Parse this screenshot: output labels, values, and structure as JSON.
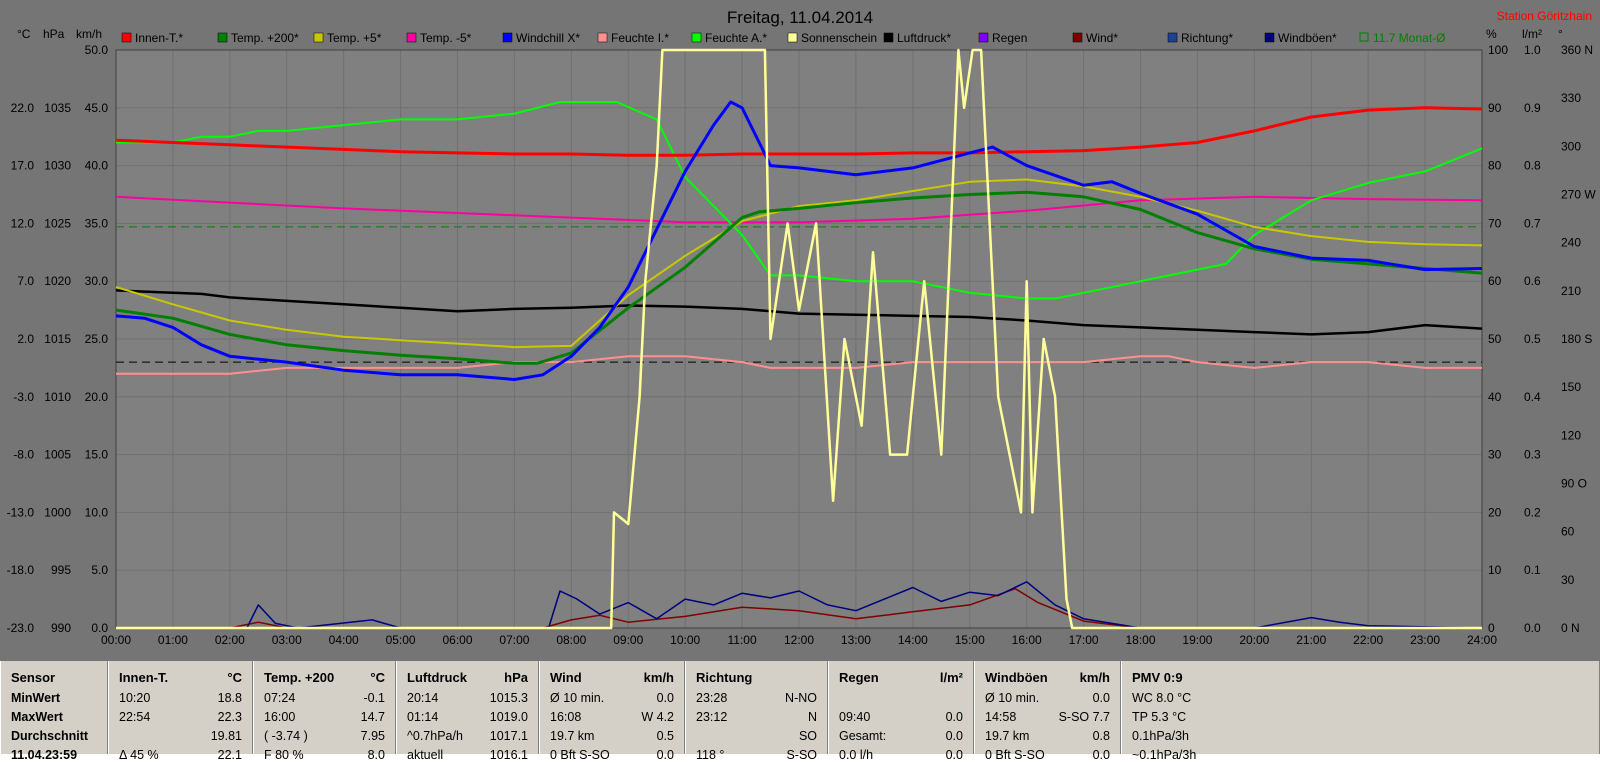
{
  "chart_data": {
    "type": "line",
    "title": "Freitag, 11.04.2014",
    "station": "Station Göritzhain",
    "x_ticks": [
      "00:00",
      "01:00",
      "02:00",
      "03:00",
      "04:00",
      "05:00",
      "06:00",
      "07:00",
      "08:00",
      "09:00",
      "10:00",
      "11:00",
      "12:00",
      "13:00",
      "14:00",
      "15:00",
      "16:00",
      "17:00",
      "18:00",
      "19:00",
      "20:00",
      "21:00",
      "22:00",
      "23:00",
      "24:00"
    ],
    "xlim": [
      0,
      24
    ],
    "axes": {
      "temp": {
        "unit": "°C",
        "ticks": [
          "22.0",
          "17.0",
          "12.0",
          "7.0",
          "2.0",
          "-3.0",
          "-8.0",
          "-13.0",
          "-18.0",
          "-23.0"
        ],
        "range": [
          -23,
          27
        ]
      },
      "pressure": {
        "unit": "hPa",
        "ticks": [
          "1035",
          "1030",
          "1025",
          "1020",
          "1015",
          "1010",
          "1005",
          "1000",
          "995",
          "990"
        ],
        "range": [
          990,
          1040
        ]
      },
      "wind": {
        "unit": "km/h",
        "ticks": [
          "50.0",
          "45.0",
          "40.0",
          "35.0",
          "30.0",
          "25.0",
          "20.0",
          "15.0",
          "10.0",
          "5.0",
          "0.0"
        ],
        "range": [
          0,
          50
        ]
      },
      "humidity": {
        "unit": "%",
        "ticks": [
          "100",
          "90",
          "80",
          "70",
          "60",
          "50",
          "40",
          "30",
          "20",
          "10",
          "0"
        ],
        "range": [
          0,
          100
        ]
      },
      "rain": {
        "unit": "l/m²",
        "ticks": [
          "1.0",
          "0.9",
          "0.8",
          "0.7",
          "0.6",
          "0.5",
          "0.4",
          "0.3",
          "0.2",
          "0.1",
          "0.0"
        ],
        "range": [
          0,
          1
        ]
      },
      "direction": {
        "unit": "°",
        "ticks": [
          "360 N",
          "330",
          "300",
          "270 W",
          "240",
          "210",
          "180 S",
          "150",
          "120",
          "90 O",
          "60",
          "30",
          "0  N"
        ],
        "range": [
          0,
          360
        ]
      }
    },
    "legend": [
      {
        "name": "Innen-T.*",
        "color": "#ff0000"
      },
      {
        "name": "Temp. +200*",
        "color": "#008000"
      },
      {
        "name": "Temp. +5*",
        "color": "#c8c800"
      },
      {
        "name": "Temp. -5*",
        "color": "#ff00a0"
      },
      {
        "name": "Windchill X*",
        "color": "#0000ff"
      },
      {
        "name": "Feuchte I.*",
        "color": "#ff9090"
      },
      {
        "name": "Feuchte A.*",
        "color": "#00ff00"
      },
      {
        "name": "Sonnenschein",
        "color": "#ffff99"
      },
      {
        "name": "Luftdruck*",
        "color": "#000000"
      },
      {
        "name": "Regen",
        "color": "#8000ff"
      },
      {
        "name": "Wind*",
        "color": "#800000"
      },
      {
        "name": "Richtung*",
        "color": "#204090"
      },
      {
        "name": "Windböen*",
        "color": "#000080"
      },
      {
        "name": "11.7 Monat-Ø",
        "color": "#008000"
      }
    ],
    "ref_lines": [
      {
        "axis": "temp",
        "value": 11.7,
        "style": "dashed",
        "color": "#008000"
      },
      {
        "axis": "temp",
        "value": 0.0,
        "style": "dashed",
        "color": "#000000"
      }
    ],
    "series": [
      {
        "name": "Innen-T.*",
        "axis": "temp",
        "color": "#ff0000",
        "x": [
          0,
          1,
          2,
          3,
          4,
          5,
          6,
          7,
          8,
          9,
          10,
          11,
          12,
          13,
          14,
          15,
          16,
          17,
          18,
          19,
          20,
          21,
          22,
          23,
          24
        ],
        "y": [
          19.2,
          19.0,
          18.8,
          18.6,
          18.4,
          18.2,
          18.1,
          18.0,
          18.0,
          17.9,
          17.9,
          18.0,
          18.0,
          18.0,
          18.1,
          18.1,
          18.2,
          18.3,
          18.6,
          19.0,
          20.0,
          21.2,
          21.8,
          22.0,
          21.9
        ]
      },
      {
        "name": "Temp. +200*",
        "axis": "temp",
        "color": "#008000",
        "x": [
          0,
          1,
          2,
          3,
          4,
          5,
          6,
          7,
          7.4,
          8,
          9,
          10,
          11,
          11.3,
          12,
          13,
          14,
          15,
          16,
          17,
          18,
          19,
          20,
          21,
          22,
          23,
          24
        ],
        "y": [
          4.5,
          3.8,
          2.4,
          1.5,
          1.0,
          0.6,
          0.3,
          -0.1,
          -0.1,
          0.8,
          4.7,
          8.2,
          12.5,
          13.0,
          13.3,
          13.8,
          14.2,
          14.5,
          14.7,
          14.3,
          13.2,
          11.2,
          9.8,
          8.9,
          8.5,
          8.1,
          7.7
        ]
      },
      {
        "name": "Temp. +5*",
        "axis": "temp",
        "color": "#c8c800",
        "x": [
          0,
          1,
          2,
          3,
          4,
          5,
          6,
          7,
          8,
          9,
          10,
          11,
          12,
          13,
          14,
          15,
          16,
          17,
          18,
          19,
          20,
          21,
          22,
          23,
          24
        ],
        "y": [
          6.5,
          5.0,
          3.6,
          2.8,
          2.2,
          1.9,
          1.6,
          1.3,
          1.4,
          5.8,
          9.2,
          12.2,
          13.5,
          14.0,
          14.8,
          15.6,
          15.8,
          15.2,
          14.3,
          13.1,
          11.7,
          10.9,
          10.4,
          10.2,
          10.1
        ]
      },
      {
        "name": "Temp. -5*",
        "axis": "temp",
        "color": "#ff00a0",
        "x": [
          0,
          2,
          4,
          6,
          8,
          10,
          12,
          14,
          16,
          18,
          20,
          22,
          24
        ],
        "y": [
          14.3,
          13.8,
          13.3,
          12.9,
          12.5,
          12.1,
          12.1,
          12.4,
          13.1,
          14.0,
          14.3,
          14.1,
          14.0
        ]
      },
      {
        "name": "Windchill X*",
        "axis": "temp",
        "color": "#0000ff",
        "x": [
          0,
          0.5,
          1,
          1.5,
          2,
          3,
          4,
          5,
          6,
          7,
          7.5,
          8,
          8.5,
          9,
          9.5,
          10,
          10.5,
          10.8,
          11,
          11.3,
          11.5,
          12,
          13,
          14,
          15,
          15.4,
          16,
          17,
          17.5,
          18,
          19,
          20,
          21,
          22,
          23,
          24
        ],
        "y": [
          4.0,
          3.8,
          3.0,
          1.5,
          0.5,
          0,
          -0.7,
          -1.1,
          -1.1,
          -1.5,
          -1.1,
          0.5,
          3.0,
          6.5,
          11.5,
          16.5,
          20.5,
          22.5,
          22.0,
          19.0,
          17.0,
          16.8,
          16.2,
          16.8,
          18.1,
          18.6,
          17.0,
          15.3,
          15.6,
          14.6,
          12.8,
          10.0,
          9.0,
          8.8,
          8.0,
          8.1
        ]
      },
      {
        "name": "Feuchte I.*",
        "axis": "humidity",
        "color": "#ff9090",
        "x": [
          0,
          2,
          3,
          4,
          5,
          6,
          7,
          8,
          9,
          10,
          11,
          11.5,
          12,
          13,
          14,
          15,
          16,
          17,
          18,
          18.5,
          19,
          20,
          21,
          22,
          23,
          24
        ],
        "y": [
          44,
          44,
          45,
          45,
          45,
          45,
          46,
          46,
          47,
          47,
          46,
          45,
          45,
          45,
          46,
          46,
          46,
          46,
          47,
          47,
          46,
          45,
          46,
          46,
          45,
          45
        ]
      },
      {
        "name": "Feuchte A.*",
        "axis": "humidity",
        "color": "#00ff00",
        "x": [
          0,
          1,
          1.5,
          2,
          2.5,
          3,
          4,
          5,
          6,
          7,
          7.8,
          8,
          8.8,
          9.5,
          10,
          11,
          11.5,
          12,
          13,
          14,
          15,
          16,
          16.5,
          17,
          18,
          19,
          19.5,
          20,
          21,
          22,
          23,
          24
        ],
        "y": [
          84,
          84,
          85,
          85,
          86,
          86,
          87,
          88,
          88,
          89,
          91,
          91,
          91,
          88,
          78,
          68,
          61,
          61,
          60,
          60,
          58,
          57,
          57,
          58,
          60,
          62,
          63,
          68,
          74,
          77,
          79,
          83
        ]
      },
      {
        "name": "Sonnenschein",
        "axis": "humidity",
        "color": "#ffff99",
        "x": [
          0,
          8,
          8.7,
          8.75,
          9.0,
          9.2,
          9.3,
          9.5,
          9.6,
          9.65,
          11.3,
          11.4,
          11.5,
          11.8,
          12.0,
          12.3,
          12.6,
          12.8,
          13.1,
          13.3,
          13.6,
          13.9,
          14.2,
          14.5,
          14.8,
          14.9,
          15.05,
          15.2,
          15.5,
          15.9,
          16.0,
          16.1,
          16.3,
          16.5,
          16.7,
          16.8,
          17,
          24
        ],
        "y": [
          0,
          0,
          0,
          20,
          18,
          40,
          60,
          80,
          100,
          100,
          100,
          100,
          50,
          70,
          55,
          70,
          22,
          50,
          35,
          65,
          30,
          30,
          60,
          30,
          100,
          90,
          100,
          100,
          40,
          20,
          60,
          20,
          50,
          40,
          5,
          0,
          0,
          0
        ]
      },
      {
        "name": "Luftdruck*",
        "axis": "pressure",
        "color": "#000000",
        "x": [
          0,
          0.5,
          1,
          1.5,
          2,
          3,
          4,
          5,
          6,
          6.5,
          7,
          8,
          9,
          10,
          11,
          12,
          13,
          14,
          15,
          16,
          17,
          18,
          19,
          20,
          21,
          22,
          23,
          24
        ],
        "y": [
          1019.2,
          1019.1,
          1019.0,
          1018.9,
          1018.6,
          1018.3,
          1018.0,
          1017.7,
          1017.4,
          1017.5,
          1017.6,
          1017.7,
          1017.9,
          1017.8,
          1017.6,
          1017.2,
          1017.1,
          1017.0,
          1016.9,
          1016.6,
          1016.2,
          1016.0,
          1015.8,
          1015.6,
          1015.4,
          1015.6,
          1016.2,
          1015.9
        ]
      },
      {
        "name": "Wind*",
        "axis": "wind",
        "color": "#800000",
        "x": [
          0,
          2,
          2.5,
          3,
          4,
          5,
          7.5,
          8,
          8.5,
          9,
          10,
          11,
          12,
          13,
          14,
          15,
          15.8,
          16.2,
          17,
          18,
          24
        ],
        "y": [
          0,
          0,
          0.5,
          0,
          0,
          0,
          0,
          0.7,
          1.1,
          0.5,
          1.0,
          1.8,
          1.5,
          0.8,
          1.4,
          2.0,
          3.4,
          2.2,
          0.6,
          0,
          0
        ]
      },
      {
        "name": "Windböen*",
        "axis": "wind",
        "color": "#000080",
        "x": [
          0,
          2.3,
          2.5,
          2.8,
          3.2,
          4.5,
          5,
          7.6,
          7.8,
          8.1,
          8.5,
          9,
          9.5,
          10,
          10.5,
          11,
          11.5,
          12,
          12.5,
          13,
          13.5,
          14,
          14.5,
          15,
          15.5,
          16,
          16.5,
          17,
          17.5,
          18,
          20,
          21,
          21.5,
          22,
          24
        ],
        "y": [
          0,
          0,
          2.0,
          0.4,
          0,
          0.7,
          0,
          0,
          3.2,
          2.5,
          1.2,
          2.2,
          0.8,
          2.5,
          2.0,
          3.0,
          2.6,
          3.2,
          2.0,
          1.5,
          2.5,
          3.5,
          2.3,
          3.1,
          2.8,
          4.0,
          2.0,
          0.8,
          0.4,
          0,
          0,
          0.9,
          0.5,
          0.2,
          0
        ]
      }
    ]
  },
  "table": {
    "sensor": {
      "header": "Sensor",
      "min": "MinWert",
      "max": "MaxWert",
      "avg": "Durchschnitt",
      "now": "11.04.23:59"
    },
    "innen": {
      "header": "Innen-T.",
      "unit": "°C",
      "min_time": "10:20",
      "min_val": "18.8",
      "max_time": "22:54",
      "max_val": "22.3",
      "avg_val": "19.81",
      "now_left": "Δ 45 %",
      "now_val": "22.1"
    },
    "temp200": {
      "header": "Temp. +200",
      "unit": "°C",
      "min_time": "07:24",
      "min_val": "-0.1",
      "max_time": "16:00",
      "max_val": "14.7",
      "avg_left": "( -3.74 )",
      "avg_val": "7.95",
      "now_left": "F 80 %",
      "now_val": "8.0"
    },
    "druck": {
      "header": "Luftdruck",
      "unit": "hPa",
      "min_time": "20:14",
      "min_val": "1015.3",
      "max_time": "01:14",
      "max_val": "1019.0",
      "avg_left": "^0.7hPa/h",
      "avg_val": "1017.1",
      "now_left": "aktuell",
      "now_val": "1016.1"
    },
    "wind": {
      "header": "Wind",
      "unit": "km/h",
      "r1_left": "Ø 10 min.",
      "r1_val": "0.0",
      "r2_left": "16:08",
      "r2_val": "W 4.2",
      "r3_left": "19.7 km",
      "r3_val": "0.5",
      "now_left": "0 Bft S-SO",
      "now_val": "0.0"
    },
    "richtung": {
      "header": "Richtung",
      "r1_left": "23:28",
      "r1_val": "N-NO",
      "r2_left": "23:12",
      "r2_val": "N",
      "r3_val": "SO",
      "now_left": "118 °",
      "now_val": "S-SO"
    },
    "regen": {
      "header": "Regen",
      "unit": "l/m²",
      "r2_left": "09:40",
      "r2_val": "0.0",
      "r3_left": "Gesamt:",
      "r3_val": "0.0",
      "now_left": "0.0 l/h",
      "now_val": "0.0"
    },
    "boeen": {
      "header": "Windböen",
      "unit": "km/h",
      "r1_left": "Ø 10 min.",
      "r1_val": "0.0",
      "r2_left": "14:58",
      "r2_val": "S-SO 7.7",
      "r3_left": "19.7 km",
      "r3_val": "0.8",
      "now_left": "0 Bft S-SO",
      "now_val": "0.0"
    },
    "pmv": {
      "header": "PMV 0:9",
      "r1": "WC 8.0 °C",
      "r2": "TP 5.3 °C",
      "r3": "0.1hPa/3h",
      "r4": "~0.1hPa/3h"
    }
  }
}
